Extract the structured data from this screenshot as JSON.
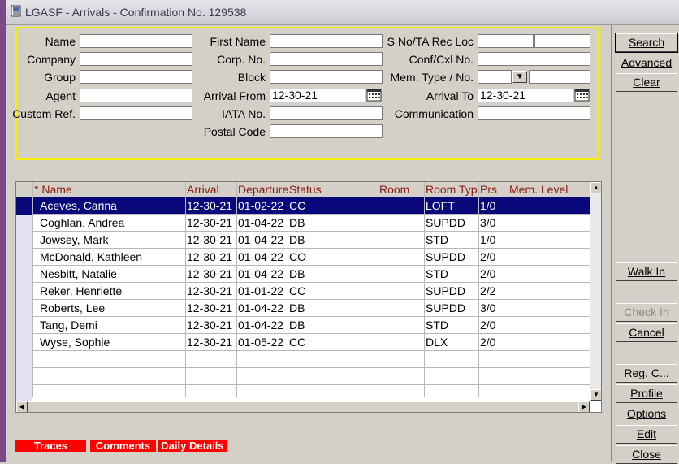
{
  "window": {
    "title": "LGASF - Arrivals - Confirmation No.  129538",
    "icon": "app-window-icon"
  },
  "search": {
    "name_label": "Name",
    "name_value": "",
    "company_label": "Company",
    "company_value": "",
    "group_label": "Group",
    "group_value": "",
    "agent_label": "Agent",
    "agent_value": "",
    "custom_ref_label": "Custom Ref.",
    "custom_ref_value": "",
    "first_name_label": "First Name",
    "first_name_value": "",
    "corp_no_label": "Corp. No.",
    "corp_no_value": "",
    "block_label": "Block",
    "block_value": "",
    "arrival_from_label": "Arrival From",
    "arrival_from_value": "12-30-21",
    "iata_label": "IATA No.",
    "iata_value": "",
    "postal_label": "Postal Code",
    "postal_value": "",
    "sno_label": "S No/TA Rec Loc",
    "sno_value_1": "",
    "sno_value_2": "",
    "conf_label": "Conf/Cxl No.",
    "conf_value": "",
    "mem_type_label": "Mem. Type / No.",
    "mem_type_value": "",
    "mem_no_value": "",
    "arrival_to_label": "Arrival To",
    "arrival_to_value": "12-30-21",
    "communication_label": "Communication",
    "communication_value": ""
  },
  "grid": {
    "columns": [
      "* Name",
      "Arrival",
      "Departure",
      "Status",
      "Room",
      "Room Type",
      "Prs",
      "Mem. Level"
    ],
    "rows": [
      [
        "Aceves, Carina",
        "12-30-21",
        "01-02-22",
        "CC",
        "",
        "LOFT",
        "1/0",
        ""
      ],
      [
        "Coghlan, Andrea",
        "12-30-21",
        "01-04-22",
        "DB",
        "",
        "SUPDD",
        "3/0",
        ""
      ],
      [
        "Jowsey, Mark",
        "12-30-21",
        "01-04-22",
        "DB",
        "",
        "STD",
        "1/0",
        ""
      ],
      [
        "McDonald, Kathleen",
        "12-30-21",
        "01-04-22",
        "CO",
        "",
        "SUPDD",
        "2/0",
        ""
      ],
      [
        "Nesbitt, Natalie",
        "12-30-21",
        "01-04-22",
        "DB",
        "",
        "STD",
        "2/0",
        ""
      ],
      [
        "Reker, Henriette",
        "12-30-21",
        "01-01-22",
        "CC",
        "",
        "SUPDD",
        "2/2",
        ""
      ],
      [
        "Roberts, Lee",
        "12-30-21",
        "01-04-22",
        "DB",
        "",
        "SUPDD",
        "3/0",
        ""
      ],
      [
        "Tang, Demi",
        "12-30-21",
        "01-04-22",
        "DB",
        "",
        "STD",
        "2/0",
        ""
      ],
      [
        "Wyse, Sophie",
        "12-30-21",
        "01-05-22",
        "CC",
        "",
        "DLX",
        "2/0",
        ""
      ]
    ],
    "selected_row": 0
  },
  "tags": {
    "traces": "Traces",
    "comments": "Comments",
    "daily_details": "Daily Details"
  },
  "buttons": {
    "search": "Search",
    "advanced": "Advanced",
    "clear": "Clear",
    "walk_in": "Walk In",
    "check_in": "Check In",
    "cancel": "Cancel",
    "reg_card": "Reg. C...",
    "profile": "Profile",
    "options": "Options",
    "edit": "Edit",
    "close": "Close"
  },
  "colors": {
    "highlight_frame": "#f5f000",
    "selected_row": "#08087a",
    "header_text": "#8b1a10",
    "tag_bg": "#ff0000"
  }
}
